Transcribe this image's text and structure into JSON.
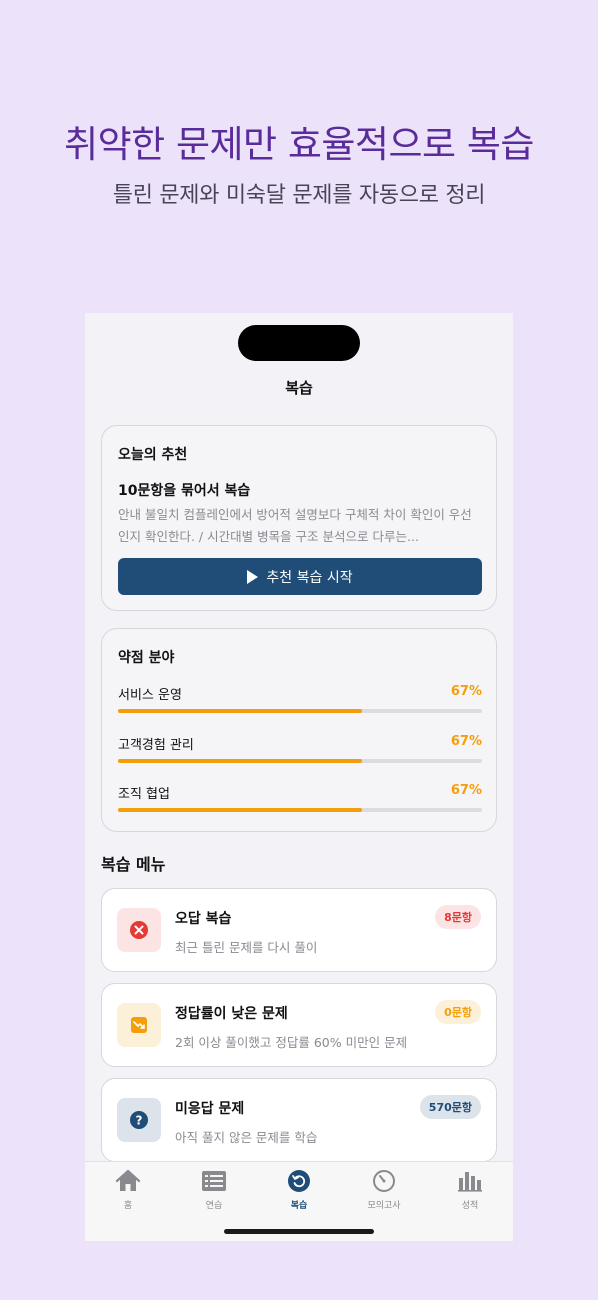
{
  "promo": {
    "headline": "취약한 문제만 효율적으로 복습",
    "subline": "틀린 문제와 미숙달 문제를 자동으로 정리"
  },
  "screen": {
    "title": "복습"
  },
  "recommendation": {
    "label": "오늘의 추천",
    "title": "10문항을 묶어서 복습",
    "description": "안내 불일치 컴플레인에서 방어적 설명보다 구체적 차이 확인이 우선인지 확인한다. / 시간대별 병목을 구조 분석으로 다루는...",
    "button_label": "추천 복습 시작"
  },
  "weak_areas": {
    "title": "약점 분야",
    "items": [
      {
        "name": "서비스 운영",
        "percent_label": "67%",
        "progress": 0.67
      },
      {
        "name": "고객경험 관리",
        "percent_label": "67%",
        "progress": 0.67
      },
      {
        "name": "조직 협업",
        "percent_label": "67%",
        "progress": 0.67
      }
    ]
  },
  "review_menu": {
    "title": "복습 메뉴",
    "items": [
      {
        "title": "오답 복습",
        "description": "최근 틀린 문제를 다시 풀이",
        "badge": "8문항",
        "icon": "x-circle-icon",
        "color": "#e53935"
      },
      {
        "title": "정답률이 낮은 문제",
        "description": "2회 이상 풀이했고 정답률 60% 미만인 문제",
        "badge": "0문항",
        "icon": "trend-down-icon",
        "color": "#f59e0b"
      },
      {
        "title": "미응답 문제",
        "description": "아직 풀지 않은 문제를 학습",
        "badge": "570문항",
        "icon": "question-circle-icon",
        "color": "#1f4d78"
      }
    ]
  },
  "tabs": [
    {
      "label": "홈",
      "icon": "home-icon",
      "active": false
    },
    {
      "label": "연습",
      "icon": "list-icon",
      "active": false
    },
    {
      "label": "복습",
      "icon": "review-icon",
      "active": true
    },
    {
      "label": "모의고사",
      "icon": "timer-icon",
      "active": false
    },
    {
      "label": "성적",
      "icon": "chart-icon",
      "active": false
    }
  ],
  "colors": {
    "accent": "#1f4d78",
    "warning": "#f59e0b",
    "error": "#e53935",
    "headline": "#5a2c9a"
  }
}
